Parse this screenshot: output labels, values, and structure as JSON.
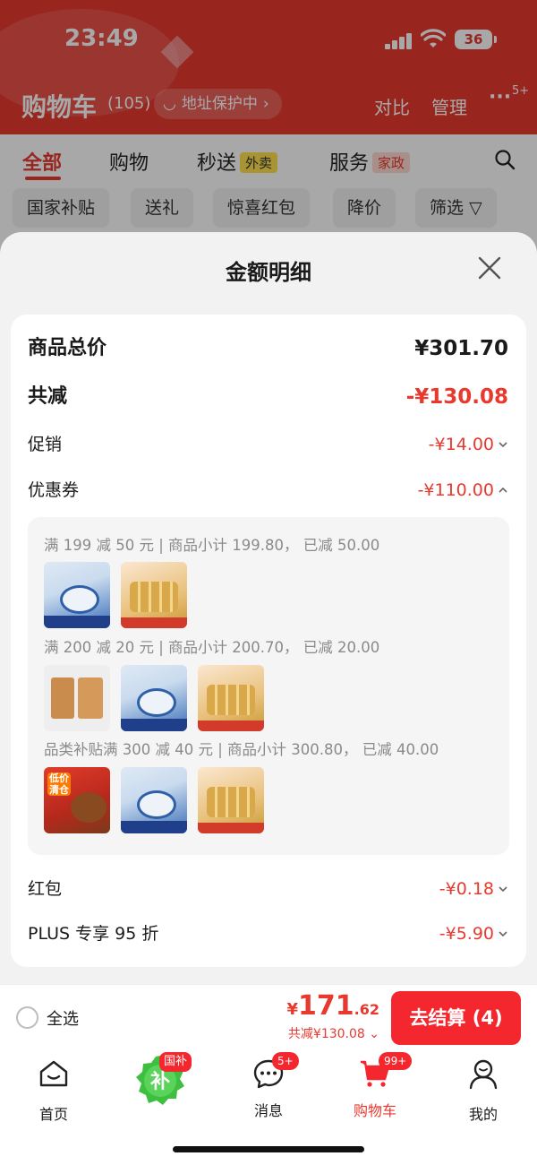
{
  "status_bar": {
    "time": "23:49",
    "battery": "36"
  },
  "header": {
    "title": "购物车",
    "count": "(105)",
    "address": "地址保护中",
    "compare": "对比",
    "manage": "管理",
    "more_badge": "5+"
  },
  "tabs": [
    {
      "label": "全部"
    },
    {
      "label": "购物"
    },
    {
      "label": "秒送",
      "tag": "外卖"
    },
    {
      "label": "服务",
      "tag": "家政"
    }
  ],
  "chips": [
    "国家补贴",
    "送礼",
    "惊喜红包",
    "降价",
    "筛选"
  ],
  "sheet": {
    "title": "金额明细",
    "rows": {
      "total_label": "商品总价",
      "total_value": "¥301.70",
      "discount_label": "共减",
      "discount_value": "-¥130.08",
      "promo_label": "促销",
      "promo_value": "-¥14.00",
      "coupon_label": "优惠券",
      "coupon_value": "-¥110.00",
      "redpacket_label": "红包",
      "redpacket_value": "-¥0.18",
      "plus_label": "PLUS 专享 95 折",
      "plus_value": "-¥5.90"
    },
    "coupons": [
      {
        "text": "满 199 减 50 元 | 商品小计 199.80， 已减 50.00"
      },
      {
        "text": "满 200 减 20 元 | 商品小计 200.70， 已减 20.00"
      },
      {
        "text": "品类补贴满 300 减 40 元 | 商品小计 300.80， 已减 40.00"
      }
    ],
    "thumb_tag": "低价清仓"
  },
  "checkout": {
    "select_all": "全选",
    "currency": "¥",
    "total_int": "171",
    "total_dec": ".62",
    "saved": "共减¥130.08",
    "button": "去结算 (4)"
  },
  "tabbar": {
    "home": "首页",
    "subsidy_badge": "国补",
    "subsidy_char": "补",
    "messages": "消息",
    "messages_badge": "5+",
    "cart": "购物车",
    "cart_badge": "99+",
    "mine": "我的"
  },
  "colors": {
    "accent": "#e8392f",
    "button": "#f3272d"
  }
}
